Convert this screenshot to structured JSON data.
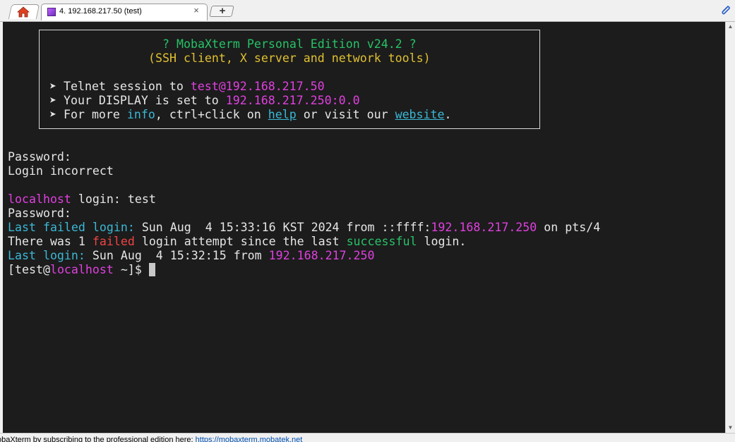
{
  "tabs": {
    "home_icon": "home-icon",
    "session_label": "4. 192.168.217.50 (test)",
    "close_glyph": "×",
    "new_tab_glyph": "+"
  },
  "terminal": {
    "banner": {
      "title": "? MobaXterm Personal Edition v24.2 ?",
      "subtitle": "(SSH client, X server and network tools)",
      "line1": {
        "prefix": "➤ Telnet session to ",
        "host": "test@192.168.217.50"
      },
      "line2": {
        "prefix": "➤ Your DISPLAY is set to ",
        "display": "192.168.217.250:0.0"
      },
      "line3": {
        "prefix": "➤ For more ",
        "info": "info",
        "mid": ", ctrl+click on ",
        "help": "help",
        "mid2": " or visit our ",
        "website": "website",
        "end": "."
      }
    },
    "lines": {
      "password1": "Password:",
      "login_incorrect": "Login incorrect",
      "login_prompt": {
        "host": "localhost",
        "rest": " login: test"
      },
      "password2": "Password:",
      "last_failed": {
        "label": "Last failed login:",
        "mid": " Sun Aug  4 15:33:16 KST 2024 from ::ffff:",
        "ip": "192.168.217.250",
        "end": " on pts/4"
      },
      "there_was": {
        "a": "There was 1 ",
        "failed": "failed",
        "b": " login attempt since the last ",
        "successful": "successful",
        "c": " login."
      },
      "last_login": {
        "label": "Last login:",
        "mid": " Sun Aug  4 15:32:15 from ",
        "ip": "192.168.217.250"
      },
      "prompt": {
        "a": "[test@",
        "host": "localhost",
        "b": " ~]$ "
      }
    }
  },
  "statusbar": {
    "text": "obaXterm by subscribing to the professional edition here: ",
    "link": "https://mobaxterm.mobatek.net"
  },
  "colors": {
    "terminal_bg": "#1c1c1c",
    "cyan": "#3bb8d6",
    "magenta": "#e040e0",
    "green": "#27c267",
    "yellow": "#e0c030",
    "red": "#ef4444"
  }
}
